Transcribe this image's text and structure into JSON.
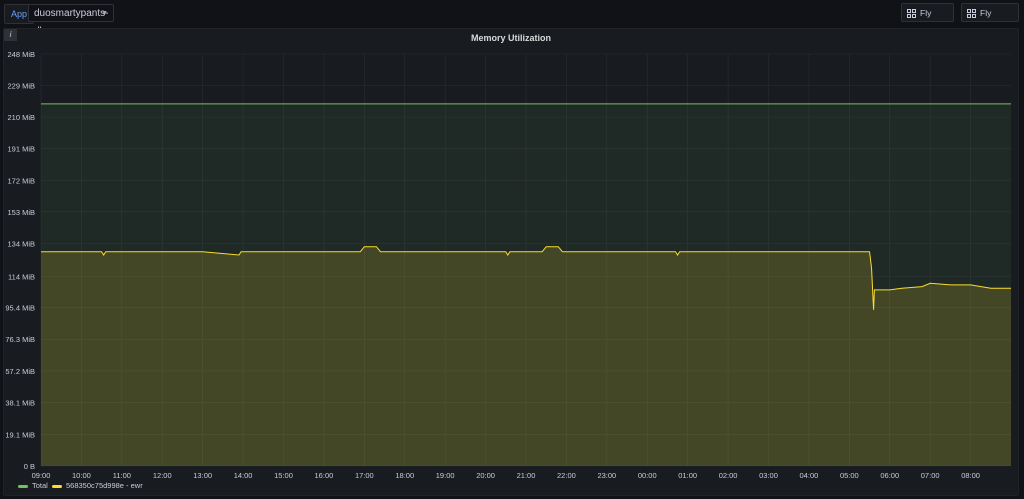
{
  "toolbar": {
    "var_label": "App",
    "var_value": "duosmartypants-db",
    "btn_edge": "Fly Edge",
    "btn_instance": "Fly Instance"
  },
  "panel": {
    "title": "Memory Utilization",
    "info": "i"
  },
  "colors": {
    "total": "#73bf69",
    "instance": "#fade2a",
    "background": "#111217",
    "panel": "#181b1f"
  },
  "icons": {
    "info": "info-icon",
    "chevron": "chevron-down-icon",
    "dashboard": "apps-icon"
  },
  "chart_data": {
    "type": "area",
    "title": "Memory Utilization",
    "ylim": [
      0,
      248
    ],
    "y_ticks": [
      "0 B",
      "19.1 MiB",
      "38.1 MiB",
      "57.2 MiB",
      "76.3 MiB",
      "95.4 MiB",
      "114 MiB",
      "134 MiB",
      "153 MiB",
      "172 MiB",
      "191 MiB",
      "210 MiB",
      "229 MiB",
      "248 MiB"
    ],
    "y_tick_values": [
      0,
      19.1,
      38.1,
      57.2,
      76.3,
      95.4,
      114,
      134,
      153,
      172,
      191,
      210,
      229,
      248
    ],
    "x_ticks": [
      "09:00",
      "10:00",
      "11:00",
      "12:00",
      "13:00",
      "14:00",
      "15:00",
      "16:00",
      "17:00",
      "18:00",
      "19:00",
      "20:00",
      "21:00",
      "22:00",
      "23:00",
      "00:00",
      "01:00",
      "02:00",
      "03:00",
      "04:00",
      "05:00",
      "06:00",
      "07:00",
      "08:00"
    ],
    "xlim": [
      0,
      24
    ],
    "grid": true,
    "legend_position": "bottom-left",
    "series": [
      {
        "name": "Total",
        "color": "#73bf69",
        "x": [
          0,
          24
        ],
        "y": [
          218,
          218
        ]
      },
      {
        "name": "568350c75d998e - ewr",
        "color": "#fade2a",
        "x": [
          0,
          1.5,
          1.55,
          1.6,
          2,
          4,
          4.9,
          4.95,
          5.0,
          6,
          7.9,
          8.0,
          8.3,
          8.4,
          9.5,
          11.5,
          11.55,
          11.6,
          12.4,
          12.5,
          12.8,
          12.9,
          14,
          15.7,
          15.75,
          15.8,
          17.5,
          18,
          19,
          20.0,
          20.5,
          20.55,
          20.6,
          20.62,
          21,
          21.3,
          21.8,
          22,
          22.5,
          23,
          23.5,
          24
        ],
        "y": [
          129,
          129,
          127,
          129,
          129,
          129,
          127,
          129,
          129,
          129,
          129,
          132,
          132,
          129,
          129,
          129,
          127,
          129,
          129,
          132,
          132,
          129,
          129,
          129,
          127,
          129,
          129,
          129,
          129,
          129,
          129,
          119,
          94,
          106,
          106,
          107,
          108,
          110,
          109,
          109,
          107,
          107
        ]
      }
    ]
  }
}
